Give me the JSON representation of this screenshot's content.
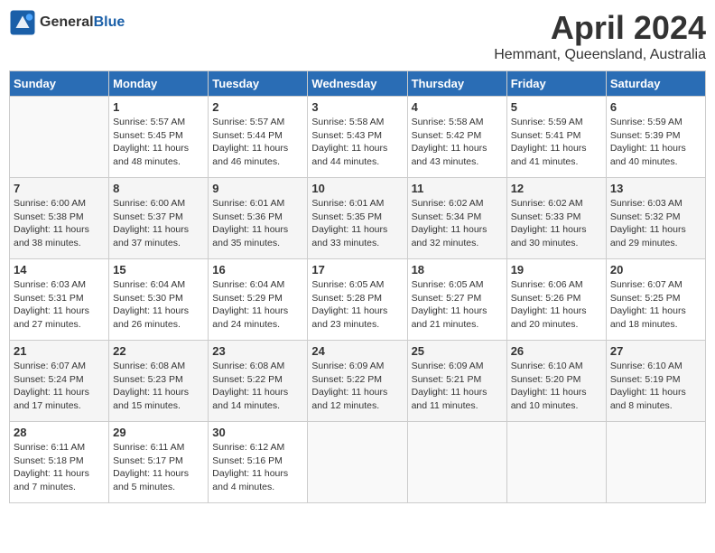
{
  "header": {
    "logo_general": "General",
    "logo_blue": "Blue",
    "month_title": "April 2024",
    "location": "Hemmant, Queensland, Australia"
  },
  "days_of_week": [
    "Sunday",
    "Monday",
    "Tuesday",
    "Wednesday",
    "Thursday",
    "Friday",
    "Saturday"
  ],
  "weeks": [
    [
      {
        "day": "",
        "sunrise": "",
        "sunset": "",
        "daylight": ""
      },
      {
        "day": "1",
        "sunrise": "Sunrise: 5:57 AM",
        "sunset": "Sunset: 5:45 PM",
        "daylight": "Daylight: 11 hours and 48 minutes."
      },
      {
        "day": "2",
        "sunrise": "Sunrise: 5:57 AM",
        "sunset": "Sunset: 5:44 PM",
        "daylight": "Daylight: 11 hours and 46 minutes."
      },
      {
        "day": "3",
        "sunrise": "Sunrise: 5:58 AM",
        "sunset": "Sunset: 5:43 PM",
        "daylight": "Daylight: 11 hours and 44 minutes."
      },
      {
        "day": "4",
        "sunrise": "Sunrise: 5:58 AM",
        "sunset": "Sunset: 5:42 PM",
        "daylight": "Daylight: 11 hours and 43 minutes."
      },
      {
        "day": "5",
        "sunrise": "Sunrise: 5:59 AM",
        "sunset": "Sunset: 5:41 PM",
        "daylight": "Daylight: 11 hours and 41 minutes."
      },
      {
        "day": "6",
        "sunrise": "Sunrise: 5:59 AM",
        "sunset": "Sunset: 5:39 PM",
        "daylight": "Daylight: 11 hours and 40 minutes."
      }
    ],
    [
      {
        "day": "7",
        "sunrise": "Sunrise: 6:00 AM",
        "sunset": "Sunset: 5:38 PM",
        "daylight": "Daylight: 11 hours and 38 minutes."
      },
      {
        "day": "8",
        "sunrise": "Sunrise: 6:00 AM",
        "sunset": "Sunset: 5:37 PM",
        "daylight": "Daylight: 11 hours and 37 minutes."
      },
      {
        "day": "9",
        "sunrise": "Sunrise: 6:01 AM",
        "sunset": "Sunset: 5:36 PM",
        "daylight": "Daylight: 11 hours and 35 minutes."
      },
      {
        "day": "10",
        "sunrise": "Sunrise: 6:01 AM",
        "sunset": "Sunset: 5:35 PM",
        "daylight": "Daylight: 11 hours and 33 minutes."
      },
      {
        "day": "11",
        "sunrise": "Sunrise: 6:02 AM",
        "sunset": "Sunset: 5:34 PM",
        "daylight": "Daylight: 11 hours and 32 minutes."
      },
      {
        "day": "12",
        "sunrise": "Sunrise: 6:02 AM",
        "sunset": "Sunset: 5:33 PM",
        "daylight": "Daylight: 11 hours and 30 minutes."
      },
      {
        "day": "13",
        "sunrise": "Sunrise: 6:03 AM",
        "sunset": "Sunset: 5:32 PM",
        "daylight": "Daylight: 11 hours and 29 minutes."
      }
    ],
    [
      {
        "day": "14",
        "sunrise": "Sunrise: 6:03 AM",
        "sunset": "Sunset: 5:31 PM",
        "daylight": "Daylight: 11 hours and 27 minutes."
      },
      {
        "day": "15",
        "sunrise": "Sunrise: 6:04 AM",
        "sunset": "Sunset: 5:30 PM",
        "daylight": "Daylight: 11 hours and 26 minutes."
      },
      {
        "day": "16",
        "sunrise": "Sunrise: 6:04 AM",
        "sunset": "Sunset: 5:29 PM",
        "daylight": "Daylight: 11 hours and 24 minutes."
      },
      {
        "day": "17",
        "sunrise": "Sunrise: 6:05 AM",
        "sunset": "Sunset: 5:28 PM",
        "daylight": "Daylight: 11 hours and 23 minutes."
      },
      {
        "day": "18",
        "sunrise": "Sunrise: 6:05 AM",
        "sunset": "Sunset: 5:27 PM",
        "daylight": "Daylight: 11 hours and 21 minutes."
      },
      {
        "day": "19",
        "sunrise": "Sunrise: 6:06 AM",
        "sunset": "Sunset: 5:26 PM",
        "daylight": "Daylight: 11 hours and 20 minutes."
      },
      {
        "day": "20",
        "sunrise": "Sunrise: 6:07 AM",
        "sunset": "Sunset: 5:25 PM",
        "daylight": "Daylight: 11 hours and 18 minutes."
      }
    ],
    [
      {
        "day": "21",
        "sunrise": "Sunrise: 6:07 AM",
        "sunset": "Sunset: 5:24 PM",
        "daylight": "Daylight: 11 hours and 17 minutes."
      },
      {
        "day": "22",
        "sunrise": "Sunrise: 6:08 AM",
        "sunset": "Sunset: 5:23 PM",
        "daylight": "Daylight: 11 hours and 15 minutes."
      },
      {
        "day": "23",
        "sunrise": "Sunrise: 6:08 AM",
        "sunset": "Sunset: 5:22 PM",
        "daylight": "Daylight: 11 hours and 14 minutes."
      },
      {
        "day": "24",
        "sunrise": "Sunrise: 6:09 AM",
        "sunset": "Sunset: 5:22 PM",
        "daylight": "Daylight: 11 hours and 12 minutes."
      },
      {
        "day": "25",
        "sunrise": "Sunrise: 6:09 AM",
        "sunset": "Sunset: 5:21 PM",
        "daylight": "Daylight: 11 hours and 11 minutes."
      },
      {
        "day": "26",
        "sunrise": "Sunrise: 6:10 AM",
        "sunset": "Sunset: 5:20 PM",
        "daylight": "Daylight: 11 hours and 10 minutes."
      },
      {
        "day": "27",
        "sunrise": "Sunrise: 6:10 AM",
        "sunset": "Sunset: 5:19 PM",
        "daylight": "Daylight: 11 hours and 8 minutes."
      }
    ],
    [
      {
        "day": "28",
        "sunrise": "Sunrise: 6:11 AM",
        "sunset": "Sunset: 5:18 PM",
        "daylight": "Daylight: 11 hours and 7 minutes."
      },
      {
        "day": "29",
        "sunrise": "Sunrise: 6:11 AM",
        "sunset": "Sunset: 5:17 PM",
        "daylight": "Daylight: 11 hours and 5 minutes."
      },
      {
        "day": "30",
        "sunrise": "Sunrise: 6:12 AM",
        "sunset": "Sunset: 5:16 PM",
        "daylight": "Daylight: 11 hours and 4 minutes."
      },
      {
        "day": "",
        "sunrise": "",
        "sunset": "",
        "daylight": ""
      },
      {
        "day": "",
        "sunrise": "",
        "sunset": "",
        "daylight": ""
      },
      {
        "day": "",
        "sunrise": "",
        "sunset": "",
        "daylight": ""
      },
      {
        "day": "",
        "sunrise": "",
        "sunset": "",
        "daylight": ""
      }
    ]
  ]
}
